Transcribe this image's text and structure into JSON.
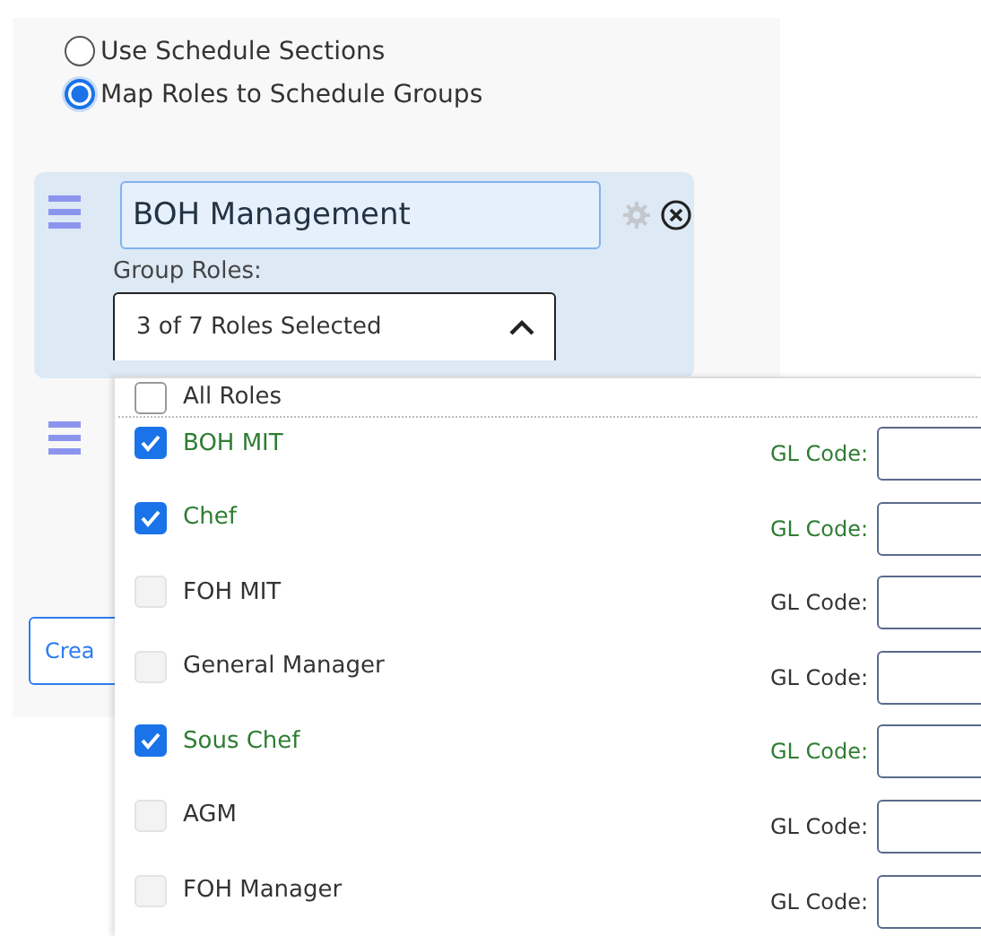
{
  "mode_options": [
    {
      "label": "Use Schedule Sections",
      "selected": false
    },
    {
      "label": "Map Roles to Schedule Groups",
      "selected": true
    }
  ],
  "groups": [
    {
      "kind": "full",
      "name": "BOH Management",
      "roles_label": "Group Roles:",
      "roles_select": {
        "value": "3 of 7 Roles Selected",
        "expanded": true
      }
    },
    {
      "kind": "handle_only"
    }
  ],
  "create_button": {
    "label": "Crea"
  },
  "role_dropdown": {
    "all_roles": {
      "label": "All Roles",
      "checked": false
    },
    "roles": [
      {
        "label": "BOH MIT",
        "checked": true,
        "gl_label": "GL Code:"
      },
      {
        "label": "Chef",
        "checked": true,
        "gl_label": "GL Code:"
      },
      {
        "label": "FOH MIT",
        "checked": false,
        "gl_label": "GL Code:"
      },
      {
        "label": "General Manager",
        "checked": false,
        "gl_label": "GL Code:"
      },
      {
        "label": "Sous Chef",
        "checked": true,
        "gl_label": "GL Code:"
      },
      {
        "label": "AGM",
        "checked": false,
        "gl_label": "GL Code:"
      },
      {
        "label": "FOH Manager",
        "checked": false,
        "gl_label": "GL Code:"
      }
    ]
  }
}
